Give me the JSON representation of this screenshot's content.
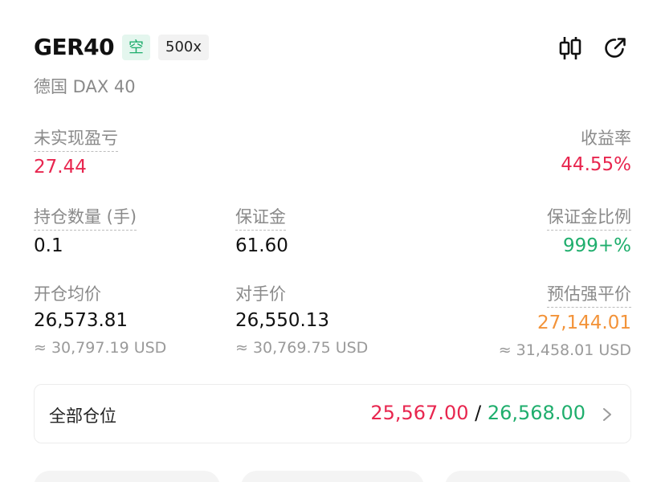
{
  "header": {
    "symbol": "GER40",
    "side": "空",
    "leverage": "500x",
    "subtitle": "德国 DAX 40",
    "icons": [
      "candlestick-chart-icon",
      "share-icon"
    ]
  },
  "stats": {
    "unrealized_pnl": {
      "label": "未实现盈亏",
      "value": "27.44"
    },
    "roe": {
      "label": "收益率",
      "value": "44.55%"
    },
    "position_size": {
      "label": "持仓数量 (手)",
      "value": "0.1"
    },
    "margin": {
      "label": "保证金",
      "value": "61.60"
    },
    "margin_ratio": {
      "label": "保证金比例",
      "value": "999+%"
    },
    "avg_open_price": {
      "label": "开仓均价",
      "value": "26,573.81",
      "usd": "≈ 30,797.19 USD"
    },
    "counter_price": {
      "label": "对手价",
      "value": "26,550.13",
      "usd": "≈ 30,769.75 USD"
    },
    "est_liq_price": {
      "label": "预估强平价",
      "value": "27,144.01",
      "usd": "≈ 31,458.01 USD"
    }
  },
  "positions": {
    "label": "全部仓位",
    "value_red": "25,567.00",
    "separator": " / ",
    "value_green": "26,568.00"
  },
  "colors": {
    "red": "#e8264f",
    "green": "#1fae6d",
    "orange": "#f39339",
    "muted": "#8a8a8a"
  }
}
